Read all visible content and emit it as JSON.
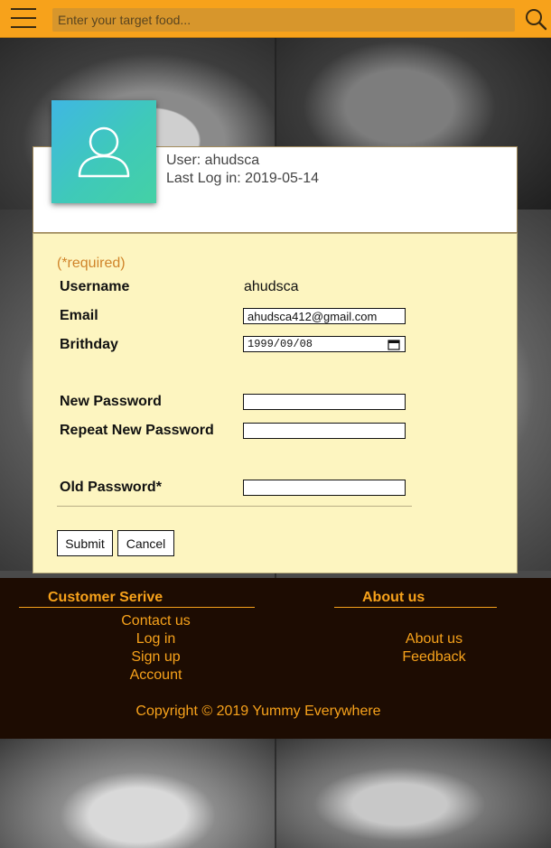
{
  "header": {
    "menu_icon": "hamburger-menu-icon",
    "search_placeholder": "Enter your target food...",
    "search_icon": "search-icon",
    "bar_color": "#f7a21b"
  },
  "profile": {
    "avatar_icon": "user-silhouette-icon",
    "user_text": "User: ahudsca",
    "last_login_text": "Last Log in: 2019-05-14"
  },
  "form": {
    "required_note": "(*required)",
    "username_label": "Username",
    "username_value": "ahudsca",
    "email_label": "Email",
    "email_value": "ahudsca412@gmail.com",
    "birthday_label": "Brithday",
    "birthday_value": "1999/09/08",
    "calendar_icon": "calendar-icon",
    "new_password_label": "New Password",
    "repeat_password_label": "Repeat New Password",
    "old_password_label": "Old Password*",
    "submit_label": "Submit",
    "cancel_label": "Cancel"
  },
  "footer": {
    "customer_heading": "Customer Serive",
    "customer_links": [
      "Contact us",
      "Log in",
      "Sign up",
      "Account"
    ],
    "about_heading": "About us",
    "about_links": [
      "About us",
      "Feedback"
    ],
    "copyright": "Copyright © 2019 Yummy Everywhere"
  }
}
